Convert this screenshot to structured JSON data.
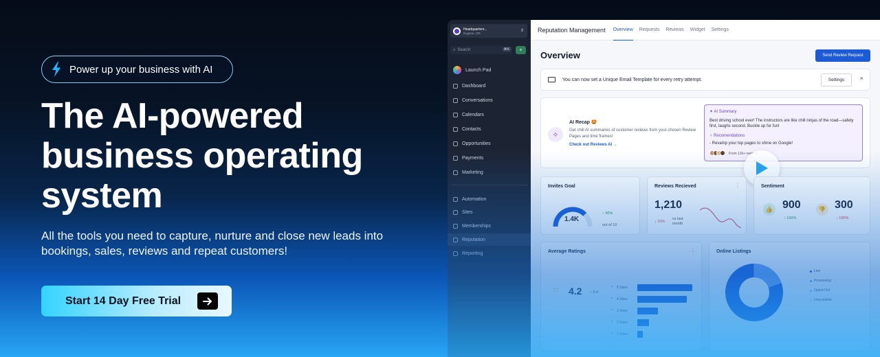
{
  "hero": {
    "pill_text": "Power up your business with AI",
    "headline": "The AI-powered business operating system",
    "subtext": "All the tools you need to capture, nurture and close new leads into bookings, sales, reviews and repeat customers!",
    "cta_label": "Start 14 Day Free Trial"
  },
  "colors": {
    "accent": "#1d5bd6",
    "cta_start": "#33d3ff",
    "bg_dark": "#050b18",
    "bg_light": "#27a6f5"
  },
  "sidebar": {
    "account_name": "Headquarters...",
    "account_location": "Eugene, OR",
    "search_placeholder": "Search",
    "search_shortcut": "⌘K",
    "add_icon": "+",
    "launch_pad": "Launch Pad",
    "items": [
      {
        "label": "Dashboard"
      },
      {
        "label": "Conversations"
      },
      {
        "label": "Calendars"
      },
      {
        "label": "Contacts"
      },
      {
        "label": "Opportunities"
      },
      {
        "label": "Payments"
      },
      {
        "label": "Marketing"
      }
    ],
    "items2": [
      {
        "label": "Automation"
      },
      {
        "label": "Sites"
      },
      {
        "label": "Memberships"
      },
      {
        "label": "Reputation"
      },
      {
        "label": "Reporting"
      }
    ]
  },
  "topbar": {
    "title": "Reputation Management",
    "tabs": [
      "Overview",
      "Requests",
      "Reviews",
      "Widget",
      "Settings"
    ]
  },
  "page": {
    "title": "Overview",
    "send_button": "Send Review Request",
    "banner_text": "You can now set a Unique Email Template for every retry attempt.",
    "banner_button": "Settings",
    "close": "×"
  },
  "recap": {
    "title": "AI Recap 🤩",
    "desc": "Get chill AI summaries of customer reviews from your chosen Review Pages and time frames!",
    "link": "Check out Reviews AI",
    "summary_title": "AI Summary",
    "summary_text": "Best driving school ever! The instructors are like chill ninjas of the road—safety first, laughs second. Buckle up for fun!",
    "recs_title": "Recomendations",
    "recs_text": "- Revamp your top pages to shine on Google!",
    "reviews_note": "From 12k+ reviews"
  },
  "invites": {
    "title": "Invites Goal",
    "value": "1.4K",
    "change": "40%",
    "note": "out of 10",
    "progress": 0.75
  },
  "received": {
    "title": "Reviews Recieved",
    "value": "1,210",
    "change": "10%",
    "note": "vs last month"
  },
  "sentiment": {
    "title": "Sentiment",
    "positive": "900",
    "positive_change": "100%",
    "negative": "300",
    "negative_change": "100%"
  },
  "ratings": {
    "title": "Average Ratings",
    "value": "4.2",
    "delta": "3.4",
    "labels": [
      "5 Stars",
      "4 Stars",
      "3 Stars",
      "2 Stars",
      "1 Stars"
    ],
    "values": [
      80,
      72,
      30,
      17,
      8
    ]
  },
  "listings": {
    "title": "Online Listings",
    "legend": [
      "Live",
      "Processing",
      "Opted Out",
      "Unavailable"
    ]
  }
}
